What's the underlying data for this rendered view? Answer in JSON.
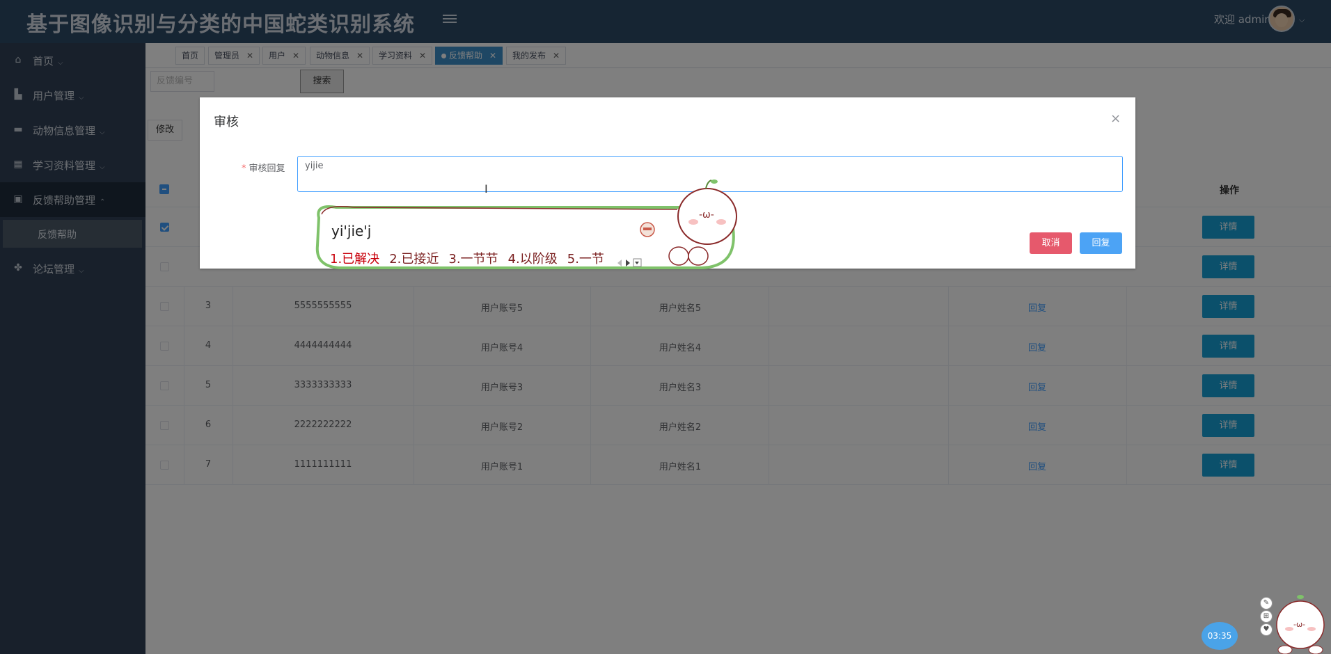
{
  "header": {
    "title": "基于图像识别与分类的中国蛇类识别系统",
    "welcome": "欢迎 admin"
  },
  "sidebar": {
    "items": [
      {
        "label": "首页",
        "icon": "home-icon"
      },
      {
        "label": "用户管理",
        "icon": "user-manage-icon"
      },
      {
        "label": "动物信息管理",
        "icon": "animal-info-icon"
      },
      {
        "label": "学习资料管理",
        "icon": "study-material-icon"
      },
      {
        "label": "反馈帮助管理",
        "icon": "feedback-help-icon"
      },
      {
        "label": "论坛管理",
        "icon": "forum-icon"
      }
    ],
    "submenu_label": "反馈帮助"
  },
  "tabs": [
    "首页",
    "管理员",
    "用户",
    "动物信息",
    "学习资料",
    "反馈帮助",
    "我的发布"
  ],
  "toolbar": {
    "search_placeholder": "反馈编号",
    "search_label": "搜索",
    "edit_label": "修改"
  },
  "table": {
    "ops_header": "操作",
    "reply_label": "回复",
    "detail_label": "详情",
    "rows": [
      {
        "index": "3",
        "code": "5555555555",
        "account": "用户账号5",
        "name": "用户姓名5"
      },
      {
        "index": "4",
        "code": "4444444444",
        "account": "用户账号4",
        "name": "用户姓名4"
      },
      {
        "index": "5",
        "code": "3333333333",
        "account": "用户账号3",
        "name": "用户姓名3"
      },
      {
        "index": "6",
        "code": "2222222222",
        "account": "用户账号2",
        "name": "用户姓名2"
      },
      {
        "index": "7",
        "code": "1111111111",
        "account": "用户账号1",
        "name": "用户姓名1"
      }
    ]
  },
  "dialog": {
    "title": "审核",
    "close": "×",
    "field_label": "审核回复",
    "field_value": "yijie",
    "cancel_label": "取消",
    "reply_label": "回复"
  },
  "ime": {
    "composition": "yi'jie'j",
    "candidates": [
      "1.已解决",
      "2.已接近",
      "3.一节节",
      "4.以阶级",
      "5.一节"
    ]
  },
  "clock": "03:35",
  "colors": {
    "header_bg": "#2c4a66",
    "sidebar_bg": "#304156",
    "accent": "#409eff",
    "detail_btn": "#17a0d6",
    "cancel_btn": "#e6596c"
  }
}
